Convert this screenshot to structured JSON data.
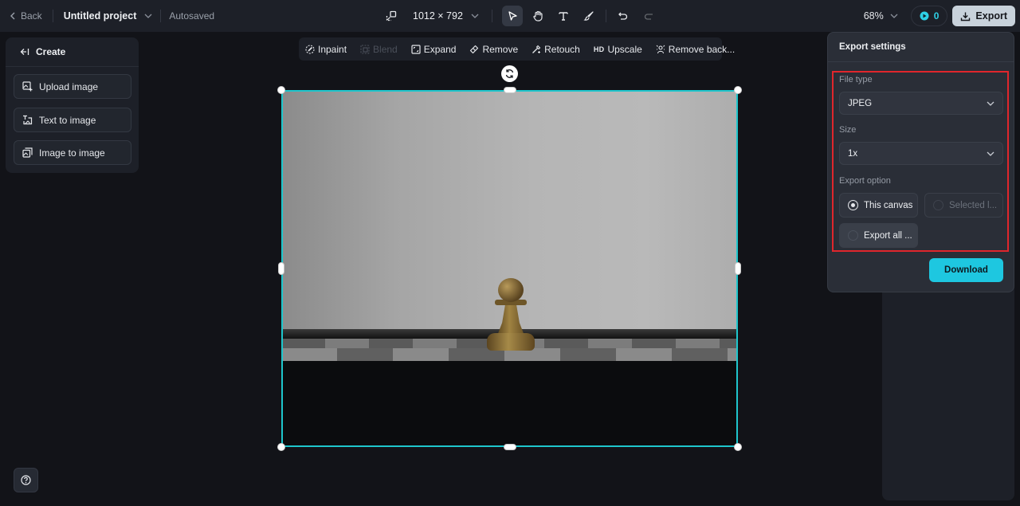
{
  "topbar": {
    "back_label": "Back",
    "project_title": "Untitled project",
    "autosave_status": "Autosaved",
    "canvas_size": "1012 × 792",
    "tools": [
      {
        "name": "select",
        "icon": "cursor-icon",
        "active": true
      },
      {
        "name": "hand",
        "icon": "hand-icon",
        "active": false
      },
      {
        "name": "text",
        "icon": "text-icon",
        "active": false
      },
      {
        "name": "brush",
        "icon": "brush-icon",
        "active": false
      },
      {
        "name": "undo",
        "icon": "undo-icon",
        "active": false
      },
      {
        "name": "redo",
        "icon": "redo-icon",
        "disabled": true
      }
    ],
    "zoom_level": "68%",
    "credits": "0",
    "export_label": "Export"
  },
  "create_panel": {
    "title": "Create",
    "items": [
      {
        "label": "Upload image",
        "icon": "upload-image-icon"
      },
      {
        "label": "Text to image",
        "icon": "text-to-image-icon"
      },
      {
        "label": "Image to image",
        "icon": "image-to-image-icon"
      }
    ]
  },
  "image_toolbar": {
    "items": [
      {
        "label": "Inpaint",
        "icon": "inpaint-icon",
        "disabled": false
      },
      {
        "label": "Blend",
        "icon": "blend-icon",
        "disabled": true
      },
      {
        "label": "Expand",
        "icon": "expand-icon",
        "disabled": false
      },
      {
        "label": "Remove",
        "icon": "eraser-icon",
        "disabled": false
      },
      {
        "label": "Retouch",
        "icon": "retouch-icon",
        "disabled": false
      },
      {
        "label": "Upscale",
        "icon": "hd-icon",
        "icon_text": "HD",
        "disabled": false
      },
      {
        "label": "Remove back...",
        "icon": "remove-background-icon",
        "disabled": false
      }
    ]
  },
  "canvas": {
    "image_description": "Bronze chess pawn on a chessboard against a grey wall",
    "selection_color": "#1ec6cc"
  },
  "export_settings": {
    "title": "Export settings",
    "file_type_label": "File type",
    "file_type_value": "JPEG",
    "size_label": "Size",
    "size_value": "1x",
    "export_option_label": "Export option",
    "options": [
      {
        "label": "This canvas",
        "selected": true,
        "disabled": false
      },
      {
        "label": "Selected l...",
        "selected": false,
        "disabled": true
      },
      {
        "label": "Export all ...",
        "selected": false,
        "disabled": false
      }
    ],
    "download_label": "Download",
    "accent_color": "#1ec7e0",
    "highlight_color": "#e0262c"
  }
}
